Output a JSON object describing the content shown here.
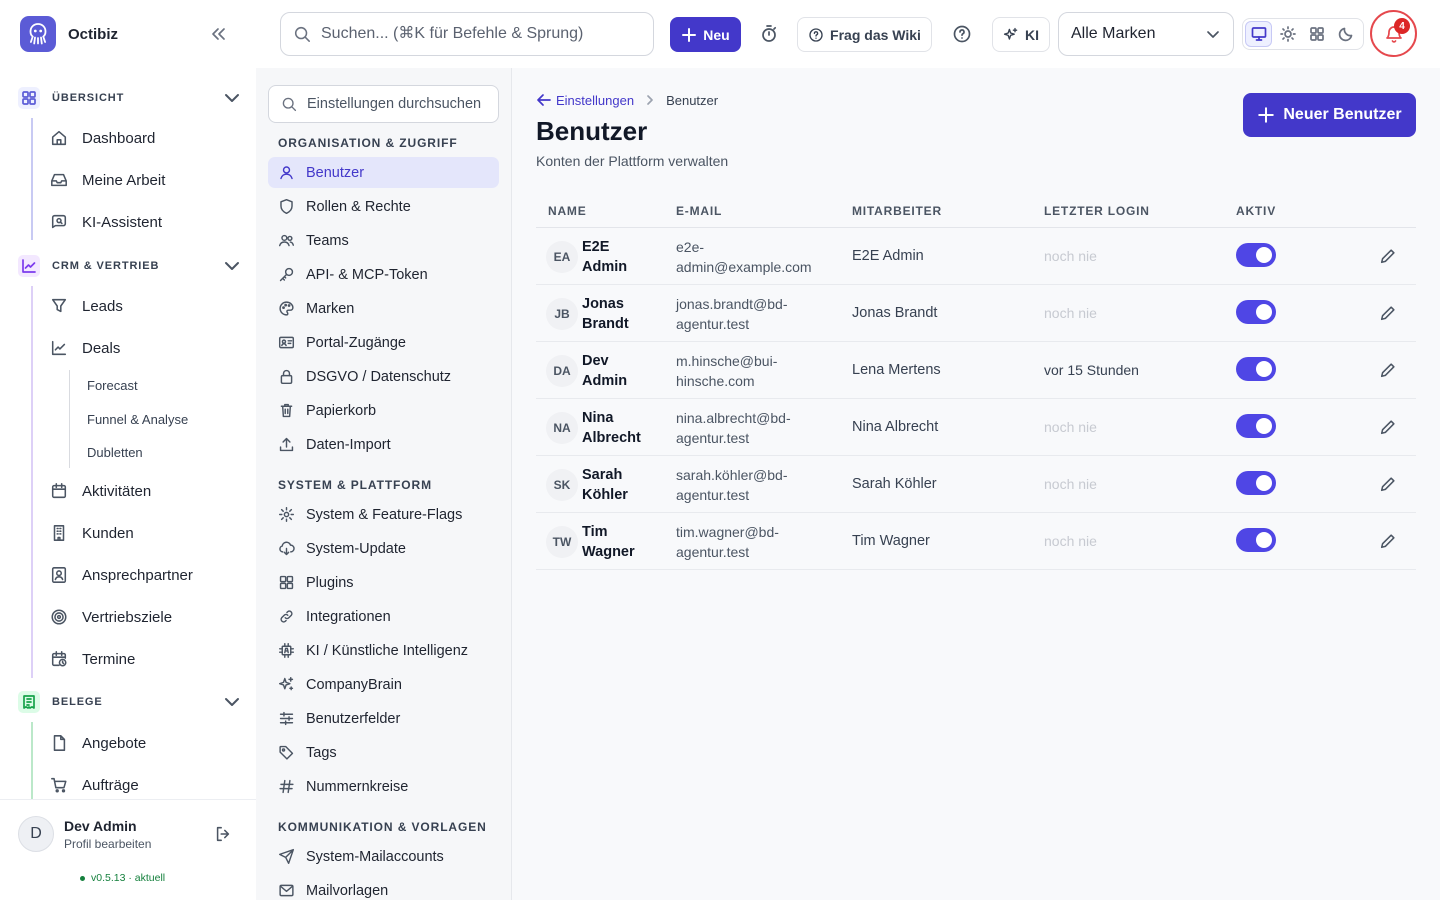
{
  "app": {
    "name": "Octibiz"
  },
  "topbar": {
    "search_placeholder": "Suchen... (⌘K für Befehle & Sprung)",
    "new_label": "Neu",
    "wiki_label": "Frag das Wiki",
    "ai_label": "KI",
    "brand_select_value": "Alle Marken",
    "notification_count": "4"
  },
  "sidebar": {
    "sections": [
      {
        "label": "ÜBERSICHT",
        "items": [
          "Dashboard",
          "Meine Arbeit",
          "KI-Assistent"
        ]
      },
      {
        "label": "CRM & VERTRIEB",
        "items": [
          "Leads",
          "Deals",
          "Aktivitäten",
          "Kunden",
          "Ansprechpartner",
          "Vertriebsziele",
          "Termine"
        ],
        "deal_subitems": [
          "Forecast",
          "Funnel & Analyse",
          "Dubletten"
        ]
      },
      {
        "label": "BELEGE",
        "items": [
          "Angebote",
          "Aufträge"
        ]
      }
    ],
    "profile": {
      "initial": "D",
      "name": "Dev Admin",
      "edit_label": "Profil bearbeiten"
    },
    "version": "v0.5.13 · aktuell"
  },
  "settings_nav": {
    "search_placeholder": "Einstellungen durchsuchen",
    "groups": [
      {
        "label": "ORGANISATION & ZUGRIFF",
        "items": [
          "Benutzer",
          "Rollen & Rechte",
          "Teams",
          "API- & MCP-Token",
          "Marken",
          "Portal-Zugänge",
          "DSGVO / Datenschutz",
          "Papierkorb",
          "Daten-Import"
        ]
      },
      {
        "label": "SYSTEM & PLATTFORM",
        "items": [
          "System & Feature-Flags",
          "System-Update",
          "Plugins",
          "Integrationen",
          "KI / Künstliche Intelligenz",
          "CompanyBrain",
          "Benutzerfelder",
          "Tags",
          "Nummernkreise"
        ]
      },
      {
        "label": "KOMMUNIKATION & VORLAGEN",
        "items": [
          "System-Mailaccounts",
          "Mailvorlagen"
        ]
      }
    ],
    "active_item": "Benutzer"
  },
  "main": {
    "breadcrumb": {
      "back": "Einstellungen",
      "current": "Benutzer"
    },
    "title": "Benutzer",
    "subtitle": "Konten der Plattform verwalten",
    "new_user_label": "Neuer Benutzer",
    "columns": [
      "NAME",
      "E-MAIL",
      "MITARBEITER",
      "LETZTER LOGIN",
      "AKTIV"
    ],
    "users": [
      {
        "initials": "EA",
        "name": "E2E Admin",
        "email": "e2e-admin@example.com",
        "employee": "E2E Admin",
        "last_login": "noch nie",
        "active": true
      },
      {
        "initials": "JB",
        "name": "Jonas Brandt",
        "email": "jonas.brandt@bd-agentur.test",
        "employee": "Jonas Brandt",
        "last_login": "noch nie",
        "active": true
      },
      {
        "initials": "DA",
        "name": "Dev Admin",
        "email": "m.hinsche@bui-hinsche.com",
        "employee": "Lena Mertens",
        "last_login": "vor 15 Stunden",
        "active": true
      },
      {
        "initials": "NA",
        "name": "Nina Albrecht",
        "email": "nina.albrecht@bd-agentur.test",
        "employee": "Nina Albrecht",
        "last_login": "noch nie",
        "active": true
      },
      {
        "initials": "SK",
        "name": "Sarah Köhler",
        "email": "sarah.köhler@bd-agentur.test",
        "employee": "Sarah Köhler",
        "last_login": "noch nie",
        "active": true
      },
      {
        "initials": "TW",
        "name": "Tim Wagner",
        "email": "tim.wagner@bd-agentur.test",
        "employee": "Tim Wagner",
        "last_login": "noch nie",
        "active": true
      }
    ]
  },
  "colors": {
    "accent": "#4338ca",
    "toggle_on": "#4f46e5",
    "notification": "#dc2626",
    "version_ok": "#15803d"
  }
}
